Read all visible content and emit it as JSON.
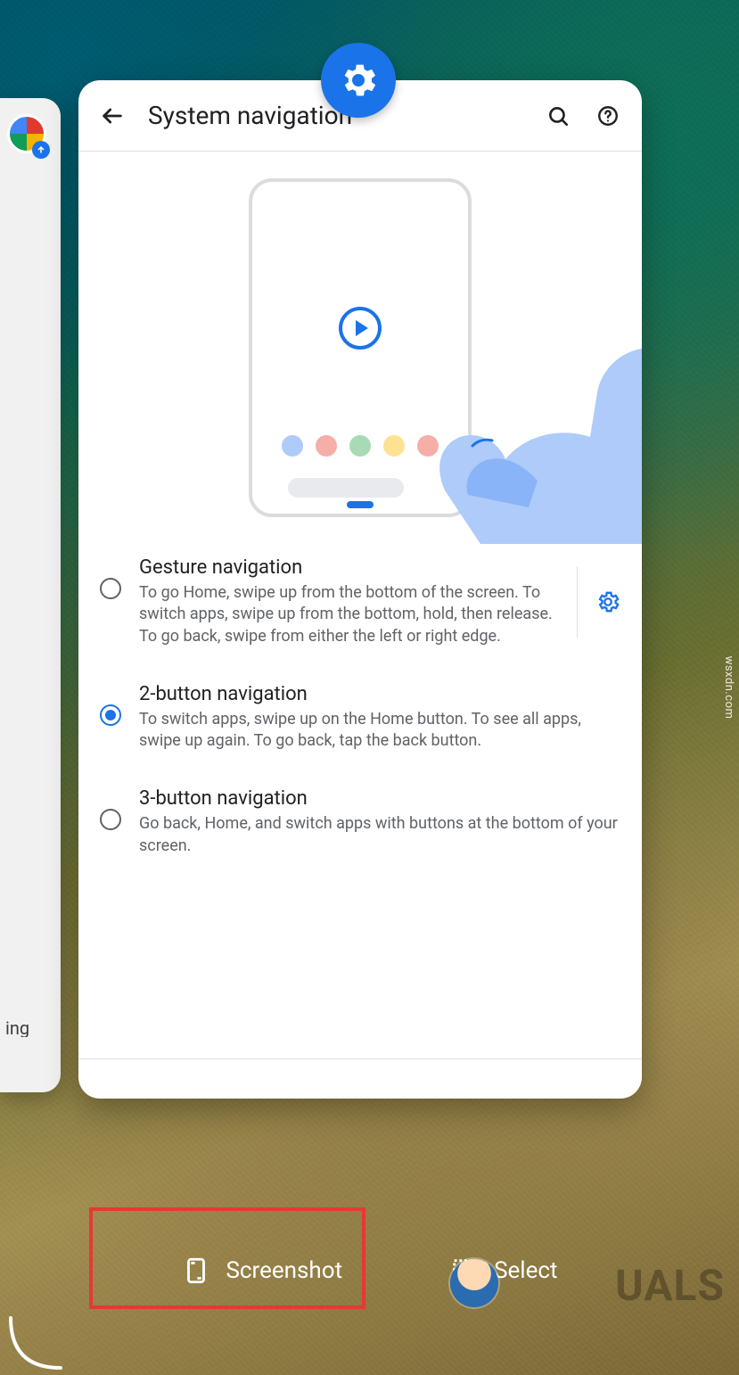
{
  "app_icon": "settings-gear",
  "header": {
    "title": "System navigation",
    "back_label": "Back",
    "search_label": "Search",
    "help_label": "Help"
  },
  "preview": {
    "play_label": "Play",
    "dot_colors": [
      "#aecbfa",
      "#f6aea9",
      "#a8dab5",
      "#fde293",
      "#f6aea9"
    ]
  },
  "options": [
    {
      "key": "gesture",
      "title": "Gesture navigation",
      "description": "To go Home, swipe up from the bottom of the screen. To switch apps, swipe up from the bottom, hold, then release. To go back, swipe from either the left or right edge.",
      "selected": false,
      "has_settings": true
    },
    {
      "key": "two_button",
      "title": "2-button navigation",
      "description": "To switch apps, swipe up on the Home button. To see all apps, swipe up again. To go back, tap the back button.",
      "selected": true,
      "has_settings": false
    },
    {
      "key": "three_button",
      "title": "3-button navigation",
      "description": "Go back, Home, and switch apps with buttons at the bottom of your screen.",
      "selected": false,
      "has_settings": false
    }
  ],
  "left_card": {
    "partial_label": "ing"
  },
  "actions": {
    "screenshot": "Screenshot",
    "select": "Select"
  },
  "watermark": "UALS",
  "source_text": "wsxdn.com",
  "colors": {
    "accent": "#1a73e8",
    "highlight": "#e53935"
  }
}
